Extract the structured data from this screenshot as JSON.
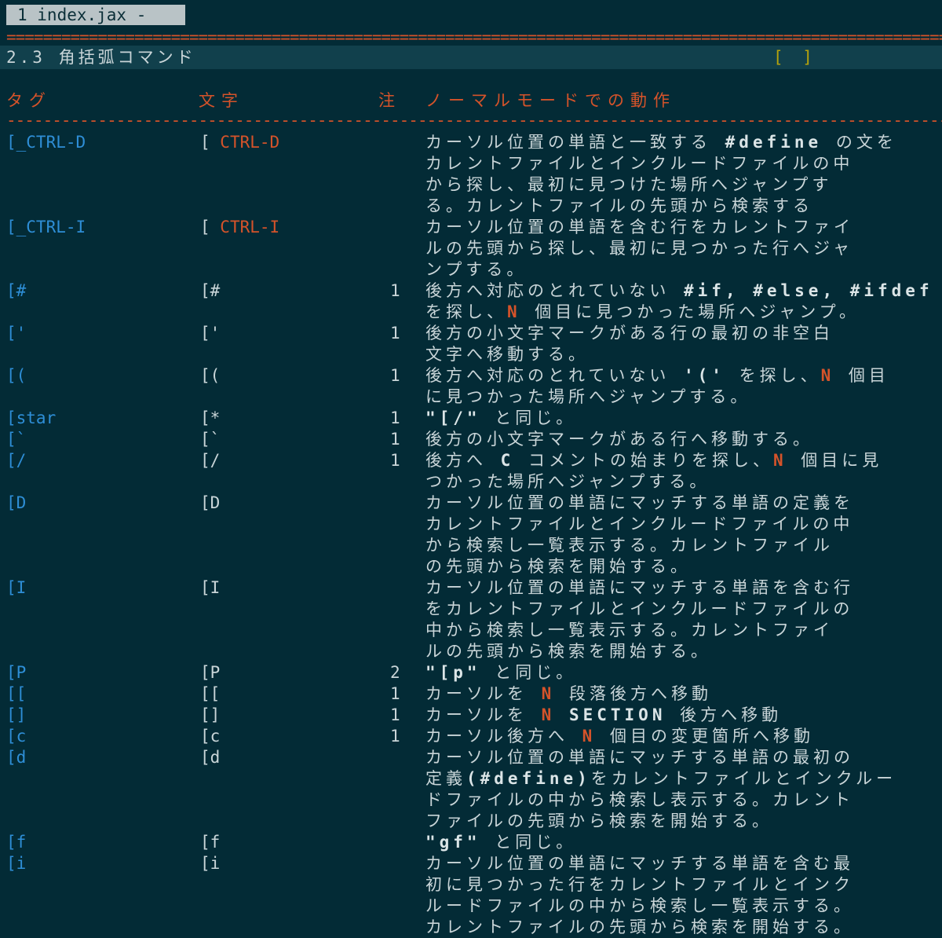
{
  "tabline": {
    "tab_label": "1 index.jax -"
  },
  "separators": {
    "top": "===========================================================================================================================",
    "header_rule": "-----------------------------------------------------------------------------------------------------------------------------"
  },
  "section": {
    "title": "2.3 角括弧コマンド",
    "tag": "[ ]"
  },
  "columns": {
    "tag": "タグ",
    "char": "文字",
    "note": "注",
    "action": "ノーマルモードでの動作"
  },
  "rows": [
    {
      "tag": "[_CTRL-D",
      "char_prefix": "[ ",
      "char_key": "CTRL-D",
      "note": "",
      "desc": [
        [
          "カーソル位置の単語と一致する ",
          ""
        ],
        [
          "#define",
          "bold"
        ],
        [
          " の文を",
          ""
        ]
      ],
      "desc_more": [
        "カレントファイルとインクルードファイルの中",
        "から探し、最初に見つけた場所へジャンプす",
        "る。カレントファイルの先頭から検索する"
      ]
    },
    {
      "tag": "[_CTRL-I",
      "char_prefix": "[ ",
      "char_key": "CTRL-I",
      "note": "",
      "desc": [
        [
          "カーソル位置の単語を含む行をカレントファイ",
          ""
        ]
      ],
      "desc_more": [
        "ルの先頭から探し、最初に見つかった行へジャ",
        "ンプする。"
      ]
    },
    {
      "tag": "[#",
      "char_prefix": "[#",
      "char_key": "",
      "note": "1",
      "desc": [
        [
          "後方へ対応のとれていない ",
          ""
        ],
        [
          "#if, #else, #ifdef",
          "bold"
        ]
      ],
      "desc2": [
        [
          "を探し、",
          ""
        ],
        [
          "N",
          "hl"
        ],
        [
          " 個目に見つかった場所へジャンプ。",
          ""
        ]
      ]
    },
    {
      "tag": "['",
      "char_prefix": "['",
      "char_key": "",
      "note": "1",
      "desc": [
        [
          "後方の小文字マークがある行の最初の非空白",
          ""
        ]
      ],
      "desc_more": [
        "文字へ移動する。"
      ]
    },
    {
      "tag": "[(",
      "char_prefix": "[(",
      "char_key": "",
      "note": "1",
      "desc": [
        [
          "後方へ対応のとれていない ",
          ""
        ],
        [
          "'('",
          "bold"
        ],
        [
          " を探し、",
          ""
        ],
        [
          "N",
          "hl"
        ],
        [
          " 個目",
          ""
        ]
      ],
      "desc_more": [
        "に見つかった場所へジャンプする。"
      ]
    },
    {
      "tag": "[star",
      "char_prefix": "[*",
      "char_key": "",
      "note": "1",
      "desc": [
        [
          "\"[/\"",
          "bold"
        ],
        [
          " と同じ。",
          ""
        ]
      ]
    },
    {
      "tag": "[`",
      "char_prefix": "[`",
      "char_key": "",
      "note": "1",
      "desc": [
        [
          "後方の小文字マークがある行へ移動する。",
          ""
        ]
      ]
    },
    {
      "tag": "[/",
      "char_prefix": "[/",
      "char_key": "",
      "note": "1",
      "desc": [
        [
          "後方へ ",
          ""
        ],
        [
          "C",
          "bold"
        ],
        [
          " コメントの始まりを探し、",
          ""
        ],
        [
          "N",
          "hl"
        ],
        [
          " 個目に見",
          ""
        ]
      ],
      "desc_more": [
        "つかった場所へジャンプする。"
      ]
    },
    {
      "tag": "[D",
      "char_prefix": "[D",
      "char_key": "",
      "note": "",
      "desc": [
        [
          "カーソル位置の単語にマッチする単語の定義を",
          ""
        ]
      ],
      "desc_more": [
        "カレントファイルとインクルードファイルの中",
        "から検索し一覧表示する。カレントファイル",
        "の先頭から検索を開始する。"
      ]
    },
    {
      "tag": "[I",
      "char_prefix": "[I",
      "char_key": "",
      "note": "",
      "desc": [
        [
          "カーソル位置の単語にマッチする単語を含む行",
          ""
        ]
      ],
      "desc_more": [
        "をカレントファイルとインクルードファイルの",
        "中から検索し一覧表示する。カレントファイ",
        "ルの先頭から検索を開始する。"
      ]
    },
    {
      "tag": "[P",
      "char_prefix": "[P",
      "char_key": "",
      "note": "2",
      "desc": [
        [
          "\"[p\"",
          "bold"
        ],
        [
          " と同じ。",
          ""
        ]
      ]
    },
    {
      "tag": "[[",
      "char_prefix": "[[",
      "char_key": "",
      "note": "1",
      "desc": [
        [
          "カーソルを ",
          ""
        ],
        [
          "N",
          "hl"
        ],
        [
          " 段落後方へ移動",
          ""
        ]
      ]
    },
    {
      "tag": "[]",
      "char_prefix": "[]",
      "char_key": "",
      "note": "1",
      "desc": [
        [
          "カーソルを ",
          ""
        ],
        [
          "N",
          "hl"
        ],
        [
          " ",
          ""
        ],
        [
          "SECTION",
          "bold"
        ],
        [
          " 後方へ移動",
          ""
        ]
      ]
    },
    {
      "tag": "[c",
      "char_prefix": "[c",
      "char_key": "",
      "note": "1",
      "desc": [
        [
          "カーソル後方へ ",
          ""
        ],
        [
          "N",
          "hl"
        ],
        [
          " 個目の変更箇所へ移動",
          ""
        ]
      ]
    },
    {
      "tag": "[d",
      "char_prefix": "[d",
      "char_key": "",
      "note": "",
      "desc": [
        [
          "カーソル位置の単語にマッチする単語の最初の",
          ""
        ]
      ],
      "desc2": [
        [
          "定義",
          ""
        ],
        [
          "(#define)",
          "bold"
        ],
        [
          "をカレントファイルとインクルー",
          ""
        ]
      ],
      "desc_more": [
        "ドファイルの中から検索し表示する。カレント",
        "ファイルの先頭から検索を開始する。"
      ]
    },
    {
      "tag": "[f",
      "char_prefix": "[f",
      "char_key": "",
      "note": "",
      "desc": [
        [
          "\"gf\"",
          "bold"
        ],
        [
          " と同じ。",
          ""
        ]
      ]
    },
    {
      "tag": "[i",
      "char_prefix": "[i",
      "char_key": "",
      "note": "",
      "desc": [
        [
          "カーソル位置の単語にマッチする単語を含む最",
          ""
        ]
      ],
      "desc_more": [
        "初に見つかった行をカレントファイルとインク",
        "ルードファイルの中から検索し一覧表示する。",
        "カレントファイルの先頭から検索を開始する。"
      ]
    }
  ],
  "colors": {
    "background": "#032b36",
    "tag_blue": "#2e8ed6",
    "orange": "#d5532a",
    "yellow": "#b5a20c",
    "text": "#c9d5d8"
  }
}
